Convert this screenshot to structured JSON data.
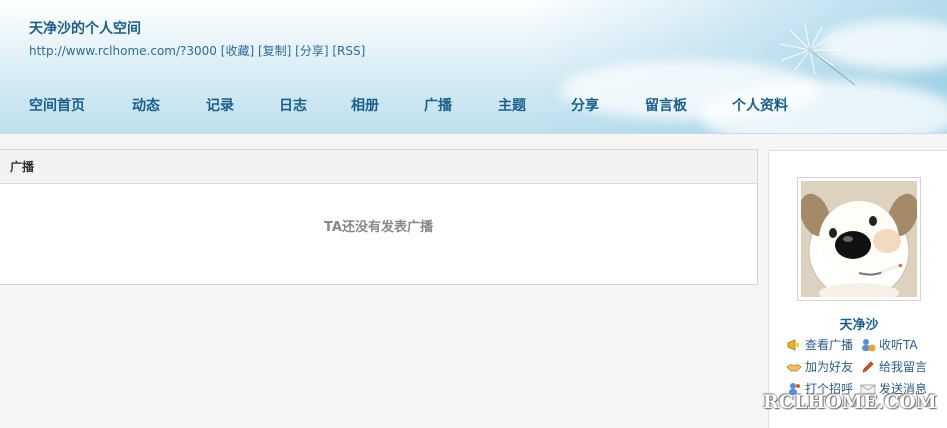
{
  "header": {
    "title": "天净沙的个人空间",
    "url": "http://www.rclhome.com/?3000",
    "links": [
      "[收藏]",
      "[复制]",
      "[分享]",
      "[RSS]"
    ]
  },
  "nav": {
    "items": [
      "空间首页",
      "动态",
      "记录",
      "日志",
      "相册",
      "广播",
      "主题",
      "分享",
      "留言板",
      "个人资料"
    ]
  },
  "panel": {
    "title": "广播",
    "empty_text": "TA还没有发表广播"
  },
  "sidebar": {
    "user_name": "天净沙",
    "actions": [
      {
        "label": "查看广播",
        "icon": "megaphone-icon"
      },
      {
        "label": "收听TA",
        "icon": "follow-icon"
      },
      {
        "label": "加为好友",
        "icon": "handshake-icon"
      },
      {
        "label": "给我留言",
        "icon": "pencil-icon"
      },
      {
        "label": "打个招呼",
        "icon": "wave-user-icon"
      },
      {
        "label": "发送消息",
        "icon": "envelope-icon"
      }
    ]
  },
  "watermark": "RCLHOME.COM",
  "colors": {
    "link": "#1b5e8a",
    "empty_text": "#888888"
  }
}
